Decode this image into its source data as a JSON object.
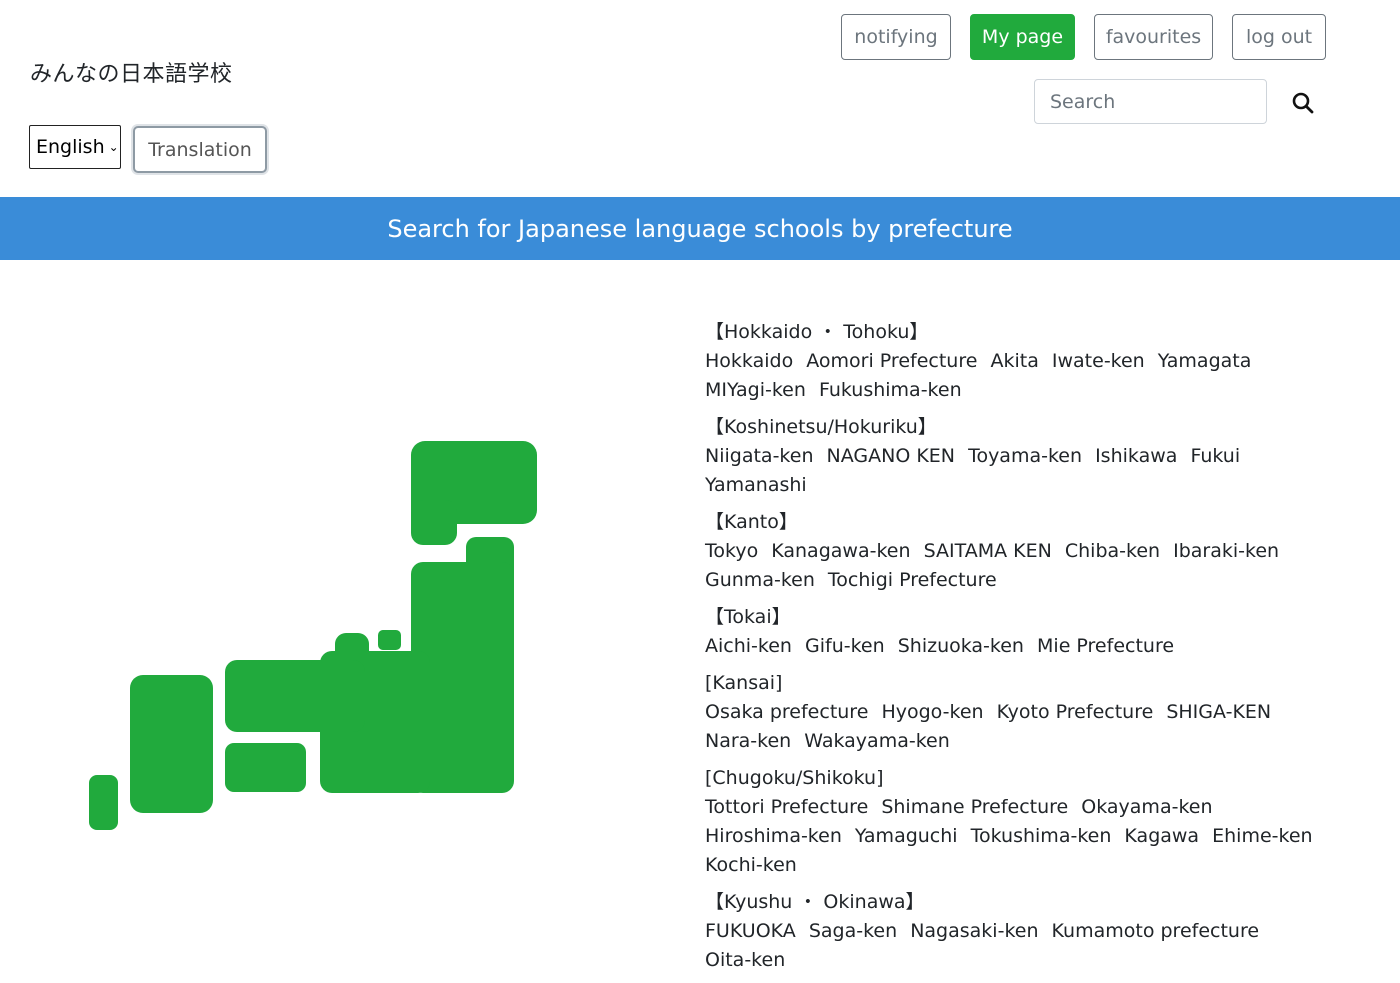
{
  "header": {
    "site_title": "みんなの日本語学校",
    "language_selected": "English",
    "translation_label": "Translation",
    "nav": {
      "notifying": "notifying",
      "my_page": "My page",
      "favourites": "favourites",
      "log_out": "log out"
    },
    "search": {
      "placeholder": "Search"
    }
  },
  "colors": {
    "accent_green": "#21aa3d",
    "banner_blue": "#3a8cd8"
  },
  "banner": {
    "title": "Search for Japanese language schools by prefecture"
  },
  "regions": [
    {
      "title": "【Hokkaido ・ Tohoku】",
      "prefectures": [
        "Hokkaido",
        "Aomori Prefecture",
        "Akita",
        "Iwate-ken",
        "Yamagata",
        "MIYagi-ken",
        "Fukushima-ken"
      ]
    },
    {
      "title": "【Koshinetsu/Hokuriku】",
      "prefectures": [
        "Niigata-ken",
        "NAGANO KEN",
        "Toyama-ken",
        "Ishikawa",
        "Fukui",
        "Yamanashi"
      ]
    },
    {
      "title": "【Kanto】",
      "prefectures": [
        "Tokyo",
        "Kanagawa-ken",
        "SAITAMA KEN",
        "Chiba-ken",
        "Ibaraki-ken",
        "Gunma-ken",
        "Tochigi Prefecture"
      ]
    },
    {
      "title": "【Tokai】",
      "prefectures": [
        "Aichi-ken",
        "Gifu-ken",
        "Shizuoka-ken",
        "Mie Prefecture"
      ]
    },
    {
      "title": "[Kansai]",
      "prefectures": [
        "Osaka prefecture",
        "Hyogo-ken",
        "Kyoto Prefecture",
        "SHIGA-KEN",
        "Nara-ken",
        "Wakayama-ken"
      ]
    },
    {
      "title": "[Chugoku/Shikoku]",
      "prefectures": [
        "Tottori Prefecture",
        "Shimane Prefecture",
        "Okayama-ken",
        "Hiroshima-ken",
        "Yamaguchi",
        "Tokushima-ken",
        "Kagawa",
        "Ehime-ken",
        "Kochi-ken"
      ]
    },
    {
      "title": "【Kyushu ・ Okinawa】",
      "prefectures": [
        "FUKUOKA",
        "Saga-ken",
        "Nagasaki-ken",
        "Kumamoto prefecture",
        "Oita-ken"
      ]
    }
  ]
}
